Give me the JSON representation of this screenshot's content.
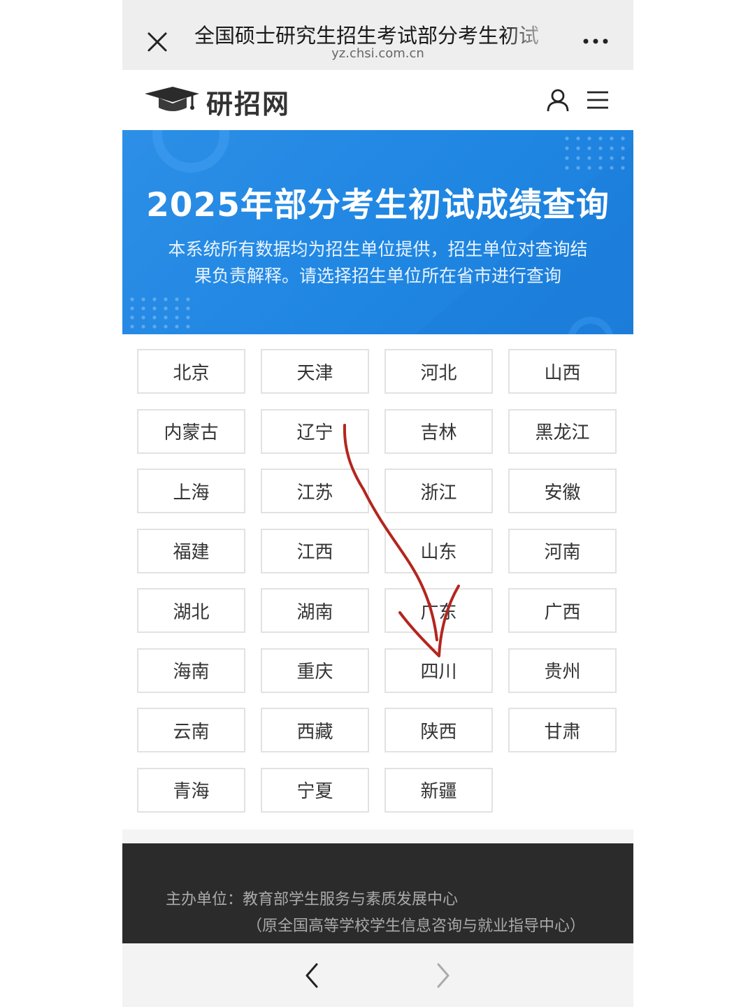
{
  "browser": {
    "page_title": "全国硕士研究生招生考试部分考生初试",
    "url": "yz.chsi.com.cn",
    "close_icon": "close-icon",
    "more_icon": "more-dots-icon"
  },
  "site": {
    "logo_text": "研招网",
    "logo_icon": "graduation-cap-icon",
    "user_icon": "user-icon",
    "menu_icon": "hamburger-menu-icon"
  },
  "banner": {
    "title": "2025年部分考生初试成绩查询",
    "description_line1": "本系统所有数据均为招生单位提供，招生单位对查询结",
    "description_line2": "果负责解释。请选择招生单位所在省市进行查询"
  },
  "provinces": [
    "北京",
    "天津",
    "河北",
    "山西",
    "内蒙古",
    "辽宁",
    "吉林",
    "黑龙江",
    "上海",
    "江苏",
    "浙江",
    "安徽",
    "福建",
    "江西",
    "山东",
    "河南",
    "湖北",
    "湖南",
    "广东",
    "广西",
    "海南",
    "重庆",
    "四川",
    "贵州",
    "云南",
    "西藏",
    "陕西",
    "甘肃",
    "青海",
    "宁夏",
    "新疆"
  ],
  "footer": {
    "host_line": "主办单位：教育部学生服务与素质发展中心",
    "former_name": "（原全国高等学校学生信息咨询与就业指导中心）"
  },
  "bottom_nav": {
    "back_icon": "chevron-left-icon",
    "forward_icon": "chevron-right-icon"
  },
  "colors": {
    "banner_blue": "#1f86e2",
    "footer_dark": "#2b2b2b",
    "annotation_red": "#b3261e"
  }
}
